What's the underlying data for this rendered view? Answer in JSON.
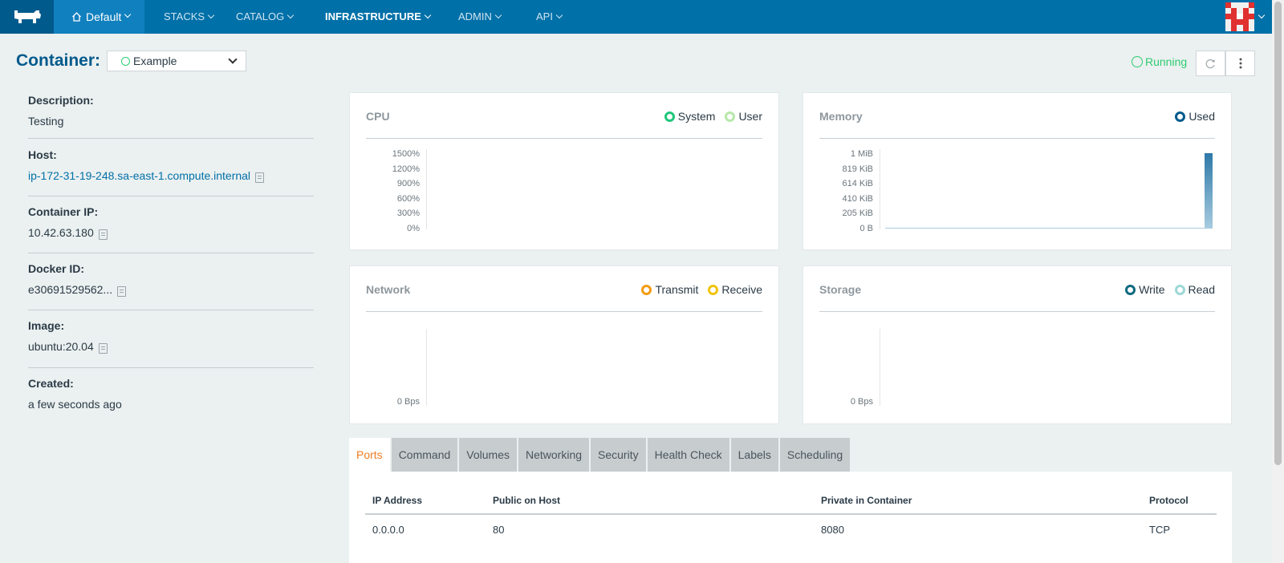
{
  "nav": {
    "environment": "Default",
    "items": [
      {
        "label": "STACKS"
      },
      {
        "label": "CATALOG"
      },
      {
        "label": "INFRASTRUCTURE"
      },
      {
        "label": "ADMIN"
      },
      {
        "label": "API"
      }
    ]
  },
  "header": {
    "title": "Container:",
    "selected_container": "Example",
    "status": "Running"
  },
  "info": [
    {
      "label": "Description:",
      "value": "Testing"
    },
    {
      "label": "Host:",
      "value": "ip-172-31-19-248.sa-east-1.compute.internal"
    },
    {
      "label": "Container IP:",
      "value": "10.42.63.180"
    },
    {
      "label": "Docker ID:",
      "value": "e30691529562..."
    },
    {
      "label": "Image:",
      "value": "ubuntu:20.04"
    },
    {
      "label": "Created:",
      "value": "a few seconds ago"
    }
  ],
  "charts": {
    "cpu": {
      "title": "CPU",
      "legend": [
        "System",
        "User"
      ],
      "ticks": [
        "1500%",
        "1200%",
        "900%",
        "600%",
        "300%",
        "0%"
      ]
    },
    "memory": {
      "title": "Memory",
      "legend": [
        "Used"
      ],
      "ticks": [
        "1 MiB",
        "819 KiB",
        "614 KiB",
        "410 KiB",
        "205 KiB",
        "0 B"
      ]
    },
    "network": {
      "title": "Network",
      "legend": [
        "Transmit",
        "Receive"
      ],
      "ticks": [
        "0 Bps"
      ]
    },
    "storage": {
      "title": "Storage",
      "legend": [
        "Write",
        "Read"
      ],
      "ticks": [
        "0 Bps"
      ]
    }
  },
  "colors": {
    "system": "#1fc77a",
    "user": "#b6e8a9",
    "used": "#005a8c",
    "transmit": "#f39c12",
    "receive": "#f1c40f",
    "write": "#0e6a80",
    "read": "#9ed8d6"
  },
  "tabs": [
    "Ports",
    "Command",
    "Volumes",
    "Networking",
    "Security",
    "Health Check",
    "Labels",
    "Scheduling"
  ],
  "ports": {
    "headers": [
      "IP Address",
      "Public on Host",
      "Private in Container",
      "Protocol"
    ],
    "rows": [
      [
        "0.0.0.0",
        "80",
        "8080",
        "TCP"
      ]
    ]
  }
}
